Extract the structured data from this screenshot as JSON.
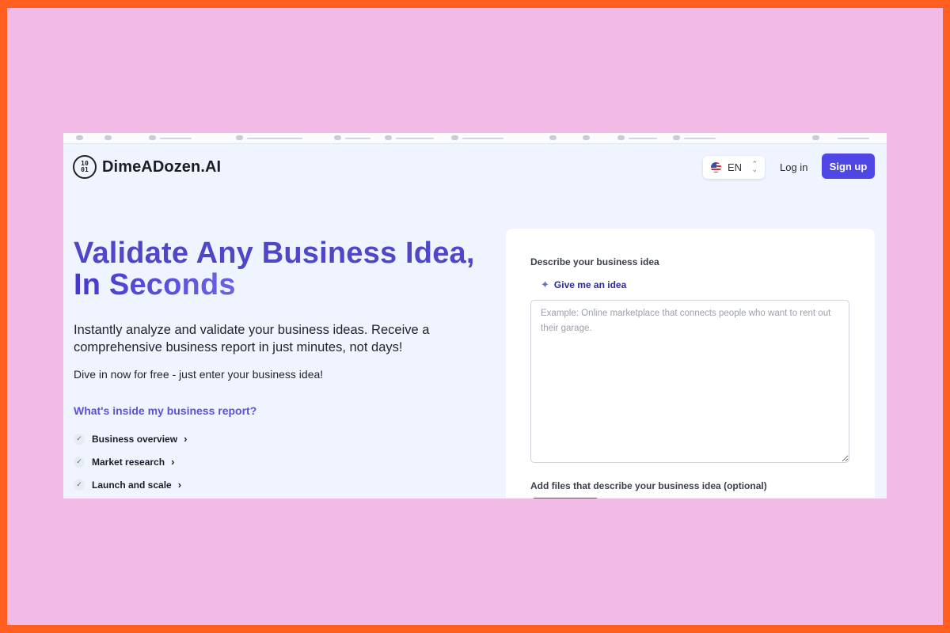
{
  "header": {
    "brand": "DimeADozen.AI",
    "logo_glyph_top": "10",
    "logo_glyph_bottom": "01",
    "language": "EN",
    "login_label": "Log in",
    "signup_label": "Sign up"
  },
  "hero": {
    "title_light": "Validate Any Business Idea,",
    "title_bold": "In Seconds",
    "subtitle": "Instantly analyze and validate your business ideas. Receive a comprehensive business report in just minutes, not days!",
    "cta_text": "Dive in now for free - just enter your business idea!",
    "report_heading": "What's inside my business report?",
    "report_items": [
      {
        "label": "Business overview"
      },
      {
        "label": "Market research"
      },
      {
        "label": "Launch and scale"
      }
    ]
  },
  "form": {
    "describe_label": "Describe your business idea",
    "give_idea_label": "Give me an idea",
    "idea_placeholder": "Example: Online marketplace that connects people who want to rent out their garage.",
    "idea_value": "",
    "files_label": "Add files that describe your business idea (optional)"
  },
  "colors": {
    "accent": "#5046e5",
    "frame_border": "#ff5e1f",
    "frame_fill": "#f2bbe6",
    "page_bg": "#eff4fe"
  },
  "icons": {
    "language_flag": "us-flag-icon",
    "language_chevron": "chevron-up-down-icon",
    "give_idea": "magic-wand-icon",
    "report_check": "check-icon",
    "report_chevron": "chevron-right-icon"
  }
}
